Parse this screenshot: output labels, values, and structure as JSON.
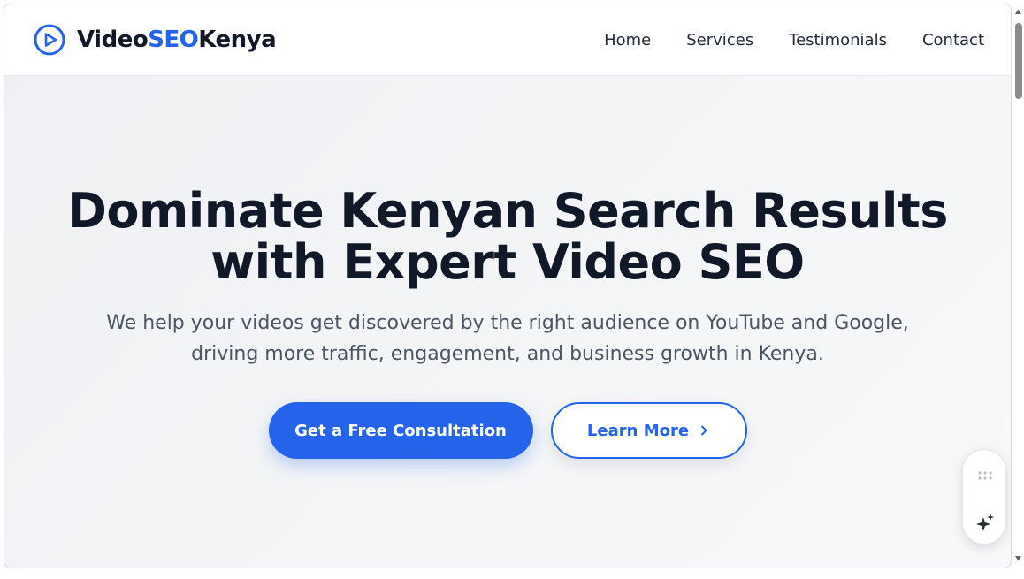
{
  "header": {
    "brand": {
      "part1": "Video",
      "part2": "SEO",
      "part3": "Kenya",
      "icon": "play-circle-icon"
    },
    "nav": [
      {
        "label": "Home"
      },
      {
        "label": "Services"
      },
      {
        "label": "Testimonials"
      },
      {
        "label": "Contact"
      }
    ]
  },
  "hero": {
    "title_line1": "Dominate Kenyan Search Results",
    "title_line2": "with Expert Video SEO",
    "subtitle_line1": "We help your videos get discovered by the right audience on YouTube and Google,",
    "subtitle_line2": "driving more traffic, engagement, and business growth in Kenya.",
    "primary_button": "Get a Free Consultation",
    "secondary_button": "Learn More",
    "secondary_icon": "chevron-right-icon"
  },
  "widget": {
    "handle_icon": "drag-handle-icon",
    "action_icon": "sparkle-icon"
  },
  "colors": {
    "accent": "#2563eb",
    "text_dark": "#111827",
    "text_muted": "#4b5563"
  }
}
